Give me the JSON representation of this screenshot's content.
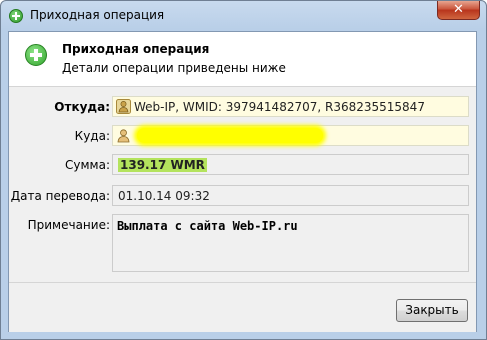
{
  "window": {
    "title": "Приходная операция",
    "close_glyph": "✕"
  },
  "header": {
    "title": "Приходная операция",
    "subtitle": "Детали операции приведены ниже"
  },
  "fields": {
    "from": {
      "label": "Откуда:",
      "value": "Web-IP, WMID: 397941482707, R368235515847"
    },
    "to": {
      "label": "Куда:",
      "value": ""
    },
    "amount": {
      "label": "Сумма:",
      "value": "139.17 WMR"
    },
    "date": {
      "label": "Дата перевода:",
      "value": "01.10.14 09:32"
    },
    "note": {
      "label": "Примечание:",
      "value": "Выплата с сайта Web-IP.ru"
    }
  },
  "footer": {
    "close_label": "Закрыть"
  },
  "colors": {
    "amount_highlight": "#b4e35d",
    "redaction": "#ffff00",
    "field_yellow": "#fffce0"
  }
}
